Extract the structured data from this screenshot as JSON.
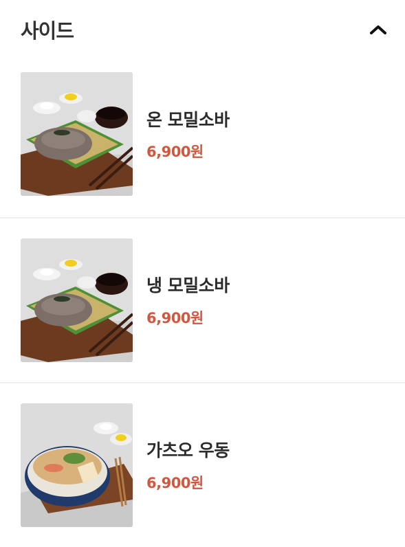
{
  "section": {
    "title": "사이드",
    "toggle_icon": "chevron-up-icon"
  },
  "items": [
    {
      "name": "온 모밀소바",
      "price": "6,900원",
      "image": "soba-set-photo"
    },
    {
      "name": "냉 모밀소바",
      "price": "6,900원",
      "image": "soba-set-photo"
    },
    {
      "name": "가츠오 우동",
      "price": "6,900원",
      "image": "udon-bowl-photo"
    }
  ],
  "colors": {
    "price": "#d2573f",
    "title": "#333333",
    "divider": "#efefef"
  }
}
